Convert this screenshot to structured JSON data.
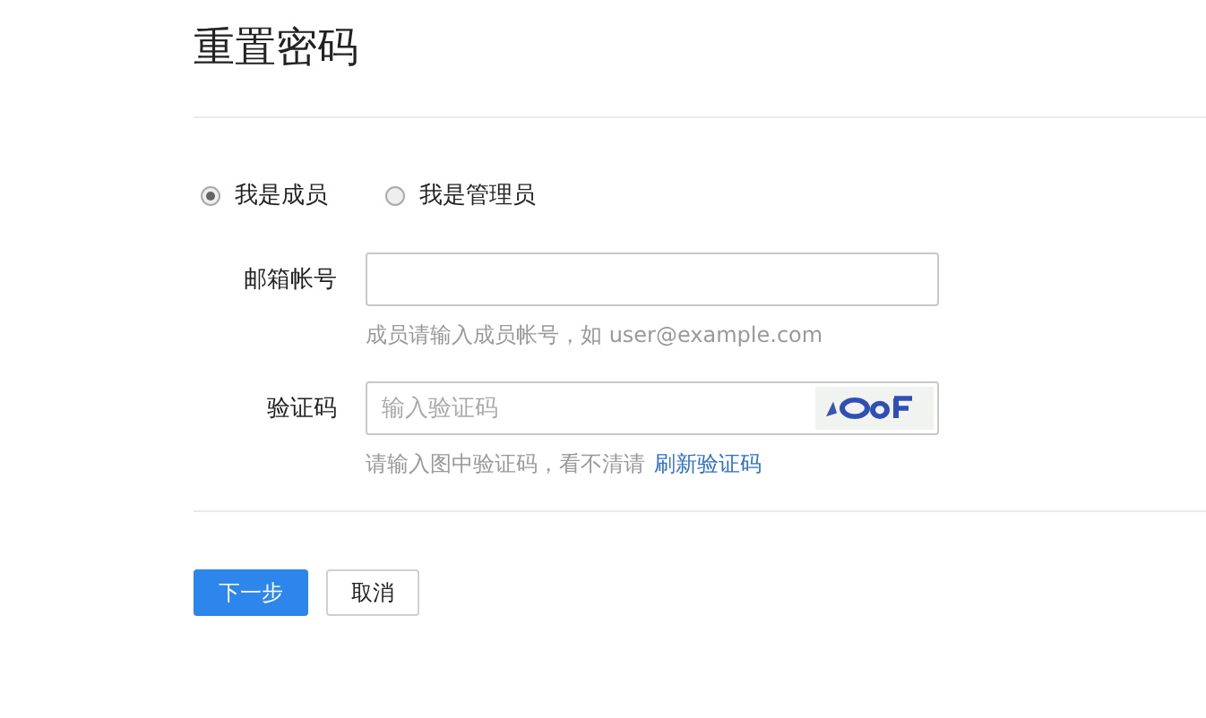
{
  "title": "重置密码",
  "roles": [
    {
      "label": "我是成员",
      "selected": true
    },
    {
      "label": "我是管理员",
      "selected": false
    }
  ],
  "fields": [
    {
      "kind": "text",
      "label": "邮箱帐号",
      "hint": "成员请输入成员帐号，如 user@example.com"
    },
    {
      "kind": "captcha",
      "label": "验证码",
      "placeholder": "输入验证码",
      "hint": "请输入图中验证码，看不清请",
      "link": "刷新验证码"
    }
  ],
  "buttons": [
    {
      "label": "下一步",
      "kind": "primary"
    },
    {
      "label": "取消",
      "kind": "default"
    }
  ]
}
